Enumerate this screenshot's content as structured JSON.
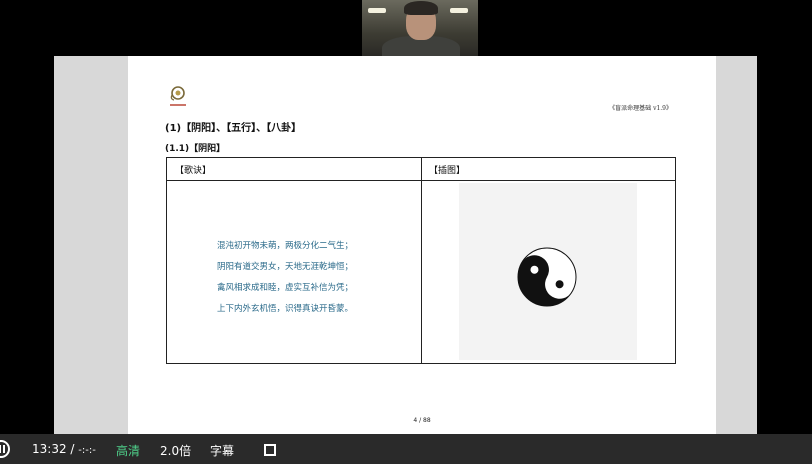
{
  "document": {
    "header_right": "《盲派命理基础 v1.9》",
    "heading1": "(1)【阴阳】、【五行】、【八卦】",
    "heading2": "(1.1)【阴阳】",
    "table": {
      "col1_header": "【歌诀】",
      "col2_header": "【插图】",
      "verses": [
        "混沌初开物未萌，两极分化二气生；",
        "阴阳有道交男女，天地无涯乾坤恒；",
        "禽风相求成和睦，虚实互补信为凭；",
        "上下内外玄机悟，识得真诀开昏蒙。"
      ],
      "illustration_icon": "yin-yang-icon"
    },
    "page_number": "4 / 88"
  },
  "player": {
    "current_time": "13:32",
    "separator": "/",
    "duration": "-:-:-",
    "quality_label": "高清",
    "speed_label": "2.0倍",
    "subtitle_label": "字幕",
    "quality_color": "#4fd18b"
  }
}
